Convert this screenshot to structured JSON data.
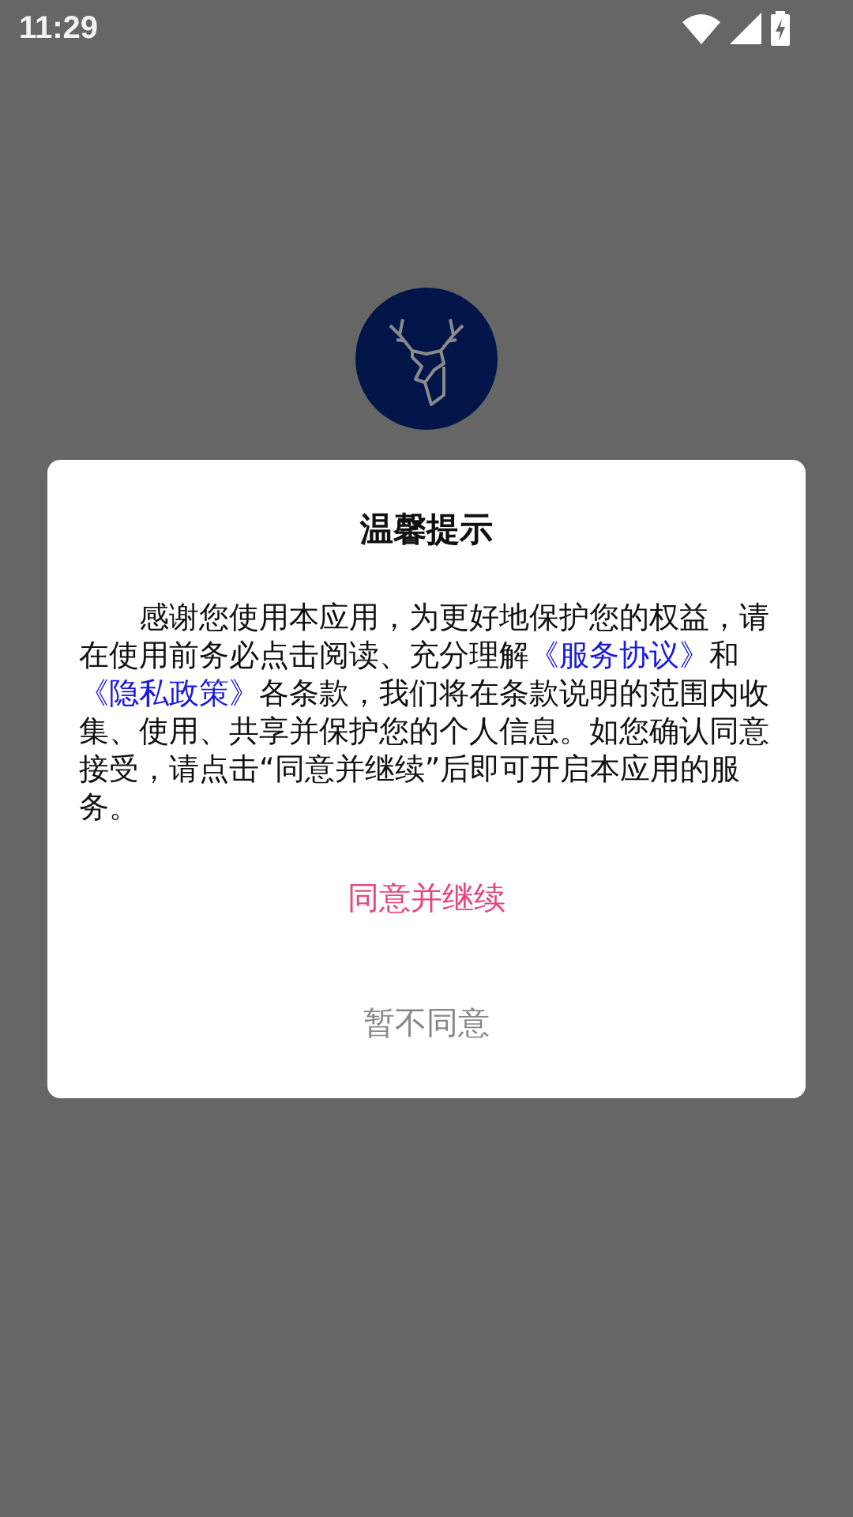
{
  "status_bar": {
    "time": "11:29"
  },
  "dialog": {
    "title": "温馨提示",
    "message": [
      {
        "kind": "text",
        "text": "感谢您使用本应用，为更好地保护您的权益，请在使用前务必点击阅读、充分理解"
      },
      {
        "kind": "link",
        "text": "《服务协议》"
      },
      {
        "kind": "text",
        "text": "和"
      },
      {
        "kind": "link",
        "text": "《隐私政策》"
      },
      {
        "kind": "text",
        "text": "各条款，我们将在条款说明的范围内收集、使用、共享并保护您的个人信息。如您确认同意接受，请点击“同意并继续”后即可开启本应用的服务。"
      }
    ],
    "buttons": [
      {
        "kind": "primary",
        "label": "同意并继续"
      },
      {
        "kind": "secondary",
        "label": "暂不同意"
      }
    ]
  }
}
